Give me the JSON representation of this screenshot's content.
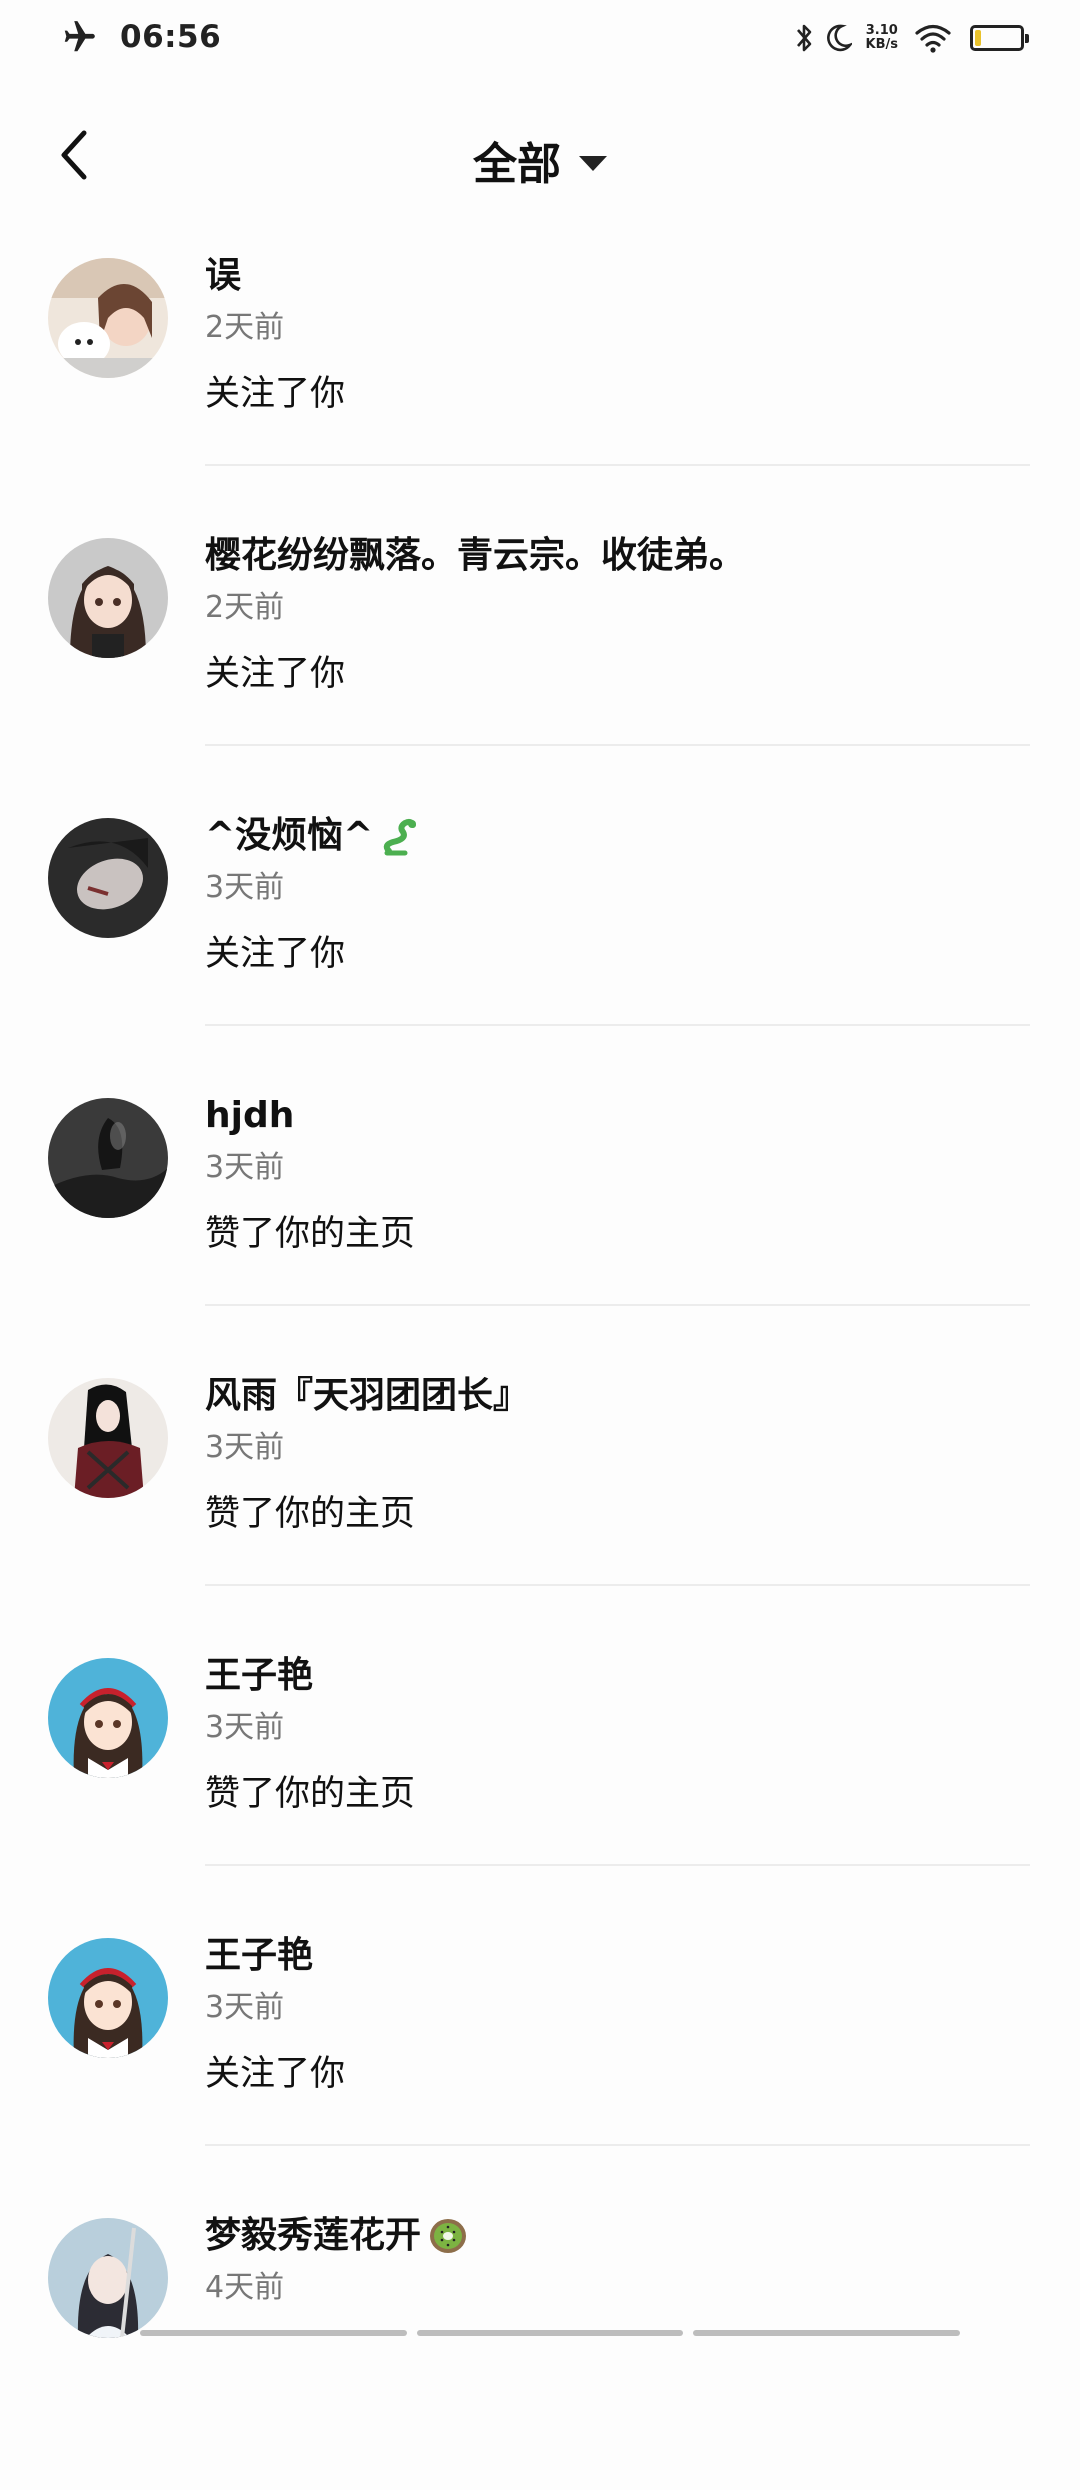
{
  "status_bar": {
    "time": "06:56",
    "net_speed_value": "3.10",
    "net_speed_unit": "KB/s",
    "icons": [
      "airplane-icon",
      "bluetooth-icon",
      "moon-icon",
      "wifi-icon",
      "battery-icon"
    ],
    "battery_color": "#e9c22c"
  },
  "header": {
    "title": "全部"
  },
  "notifications": [
    {
      "name": "误",
      "time": "2天前",
      "action": "关注了你",
      "avatar_color": "#e8d8cc"
    },
    {
      "name": "樱花纷纷飘落。青云宗。收徒弟。",
      "time": "2天前",
      "action": "关注了你",
      "avatar_color": "#c8c8c8"
    },
    {
      "name": "^没烦恼^",
      "time": "3天前",
      "action": "关注了你",
      "avatar_color": "#3a3a3a",
      "emoji": "snake-emoji"
    },
    {
      "name": "hjdh",
      "time": "3天前",
      "action": "赞了你的主页",
      "avatar_color": "#2c2c2c"
    },
    {
      "name": "风雨『天羽团团长』",
      "time": "3天前",
      "action": "赞了你的主页",
      "avatar_color": "#efe8e2"
    },
    {
      "name": "王子艳",
      "time": "3天前",
      "action": "赞了你的主页",
      "avatar_color": "#4fb3d9"
    },
    {
      "name": "王子艳",
      "time": "3天前",
      "action": "关注了你",
      "avatar_color": "#4fb3d9"
    },
    {
      "name": "梦毅秀莲花开",
      "time": "4天前",
      "action": "",
      "avatar_color": "#9fb8c8",
      "emoji": "kiwi-emoji"
    }
  ]
}
